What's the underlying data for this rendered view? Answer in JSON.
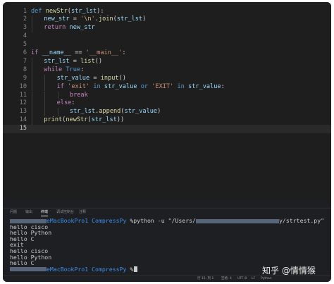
{
  "editor": {
    "lines": [
      {
        "num": "1",
        "current": false,
        "indent": 0,
        "tokens": [
          [
            "def",
            "def "
          ],
          [
            "fn",
            "newStr"
          ],
          [
            "plain",
            "("
          ],
          [
            "var",
            "str_lst"
          ],
          [
            "plain",
            "):"
          ]
        ]
      },
      {
        "num": "2",
        "current": false,
        "indent": 1,
        "tokens": [
          [
            "var",
            "new_str"
          ],
          [
            "plain",
            " = "
          ],
          [
            "str",
            "'"
          ],
          [
            "esc",
            "\\n"
          ],
          [
            "str",
            "'"
          ],
          [
            "plain",
            "."
          ],
          [
            "fn",
            "join"
          ],
          [
            "plain",
            "("
          ],
          [
            "var",
            "str_lst"
          ],
          [
            "plain",
            ")"
          ]
        ]
      },
      {
        "num": "3",
        "current": false,
        "indent": 1,
        "tokens": [
          [
            "kw",
            "return"
          ],
          [
            "plain",
            " "
          ],
          [
            "var",
            "new_str"
          ]
        ]
      },
      {
        "num": "4",
        "current": false,
        "indent": 0,
        "tokens": []
      },
      {
        "num": "5",
        "current": false,
        "indent": 0,
        "tokens": []
      },
      {
        "num": "6",
        "current": false,
        "indent": 0,
        "tokens": [
          [
            "kw",
            "if"
          ],
          [
            "plain",
            " "
          ],
          [
            "var",
            "__name__"
          ],
          [
            "plain",
            " == "
          ],
          [
            "str",
            "'__main__'"
          ],
          [
            "plain",
            ":"
          ]
        ]
      },
      {
        "num": "7",
        "current": false,
        "indent": 1,
        "tokens": [
          [
            "var",
            "str_lst"
          ],
          [
            "plain",
            " = "
          ],
          [
            "fn",
            "list"
          ],
          [
            "plain",
            "()"
          ]
        ]
      },
      {
        "num": "8",
        "current": false,
        "indent": 1,
        "tokens": [
          [
            "kw",
            "while"
          ],
          [
            "plain",
            " "
          ],
          [
            "def",
            "True"
          ],
          [
            "plain",
            ":"
          ]
        ]
      },
      {
        "num": "9",
        "current": false,
        "indent": 2,
        "tokens": [
          [
            "var",
            "str_value"
          ],
          [
            "plain",
            " = "
          ],
          [
            "fn",
            "input"
          ],
          [
            "plain",
            "()"
          ]
        ]
      },
      {
        "num": "10",
        "current": false,
        "indent": 2,
        "tokens": [
          [
            "kw",
            "if"
          ],
          [
            "plain",
            " "
          ],
          [
            "str",
            "'exit'"
          ],
          [
            "plain",
            " "
          ],
          [
            "def",
            "in"
          ],
          [
            "plain",
            " "
          ],
          [
            "var",
            "str_value"
          ],
          [
            "plain",
            " "
          ],
          [
            "def",
            "or"
          ],
          [
            "plain",
            " "
          ],
          [
            "str",
            "'EXIT'"
          ],
          [
            "plain",
            " "
          ],
          [
            "def",
            "in"
          ],
          [
            "plain",
            " "
          ],
          [
            "var",
            "str_value"
          ],
          [
            "plain",
            ":"
          ]
        ]
      },
      {
        "num": "11",
        "current": false,
        "indent": 3,
        "tokens": [
          [
            "kw",
            "break"
          ]
        ]
      },
      {
        "num": "12",
        "current": false,
        "indent": 2,
        "tokens": [
          [
            "kw",
            "else"
          ],
          [
            "plain",
            ":"
          ]
        ]
      },
      {
        "num": "13",
        "current": false,
        "indent": 3,
        "tokens": [
          [
            "var",
            "str_lst"
          ],
          [
            "plain",
            "."
          ],
          [
            "fn",
            "append"
          ],
          [
            "plain",
            "("
          ],
          [
            "var",
            "str_value"
          ],
          [
            "plain",
            ")"
          ]
        ]
      },
      {
        "num": "14",
        "current": false,
        "indent": 1,
        "tokens": [
          [
            "fn",
            "print"
          ],
          [
            "plain",
            "("
          ],
          [
            "fn",
            "newStr"
          ],
          [
            "plain",
            "("
          ],
          [
            "var",
            "str_lst"
          ],
          [
            "plain",
            "))"
          ]
        ]
      },
      {
        "num": "15",
        "current": true,
        "indent": 0,
        "tokens": []
      }
    ]
  },
  "panel": {
    "tabs": [
      {
        "label": "问题",
        "active": false
      },
      {
        "label": "输出",
        "active": false
      },
      {
        "label": "终端",
        "active": true
      },
      {
        "label": "调试控制台",
        "active": false
      },
      {
        "label": "注释",
        "active": false
      }
    ]
  },
  "terminal": {
    "prompt_host": "eMacBookPro1",
    "prompt_dir": "CompressPy",
    "command": "%python -u \"/Users/",
    "command_tail": "y/strtest.py\"",
    "final_prompt_suffix": "%",
    "output_lines": [
      "hello cisco",
      "hello Python",
      "hello C",
      "exit",
      "hello cisco",
      "hello Python",
      "hello C"
    ]
  },
  "statusbar": {
    "position": "行 15, 列 1",
    "spaces": "空格: 4",
    "encoding": "UTF-8",
    "eol": "LF",
    "language": "Python"
  },
  "watermark": "知乎 @情情猴",
  "colors": {
    "keyword": "#c586c0",
    "storage": "#569cd6",
    "function": "#dcdcaa",
    "string": "#ce9178",
    "variable": "#9cdcfe",
    "prompt": "#3b8eea"
  }
}
